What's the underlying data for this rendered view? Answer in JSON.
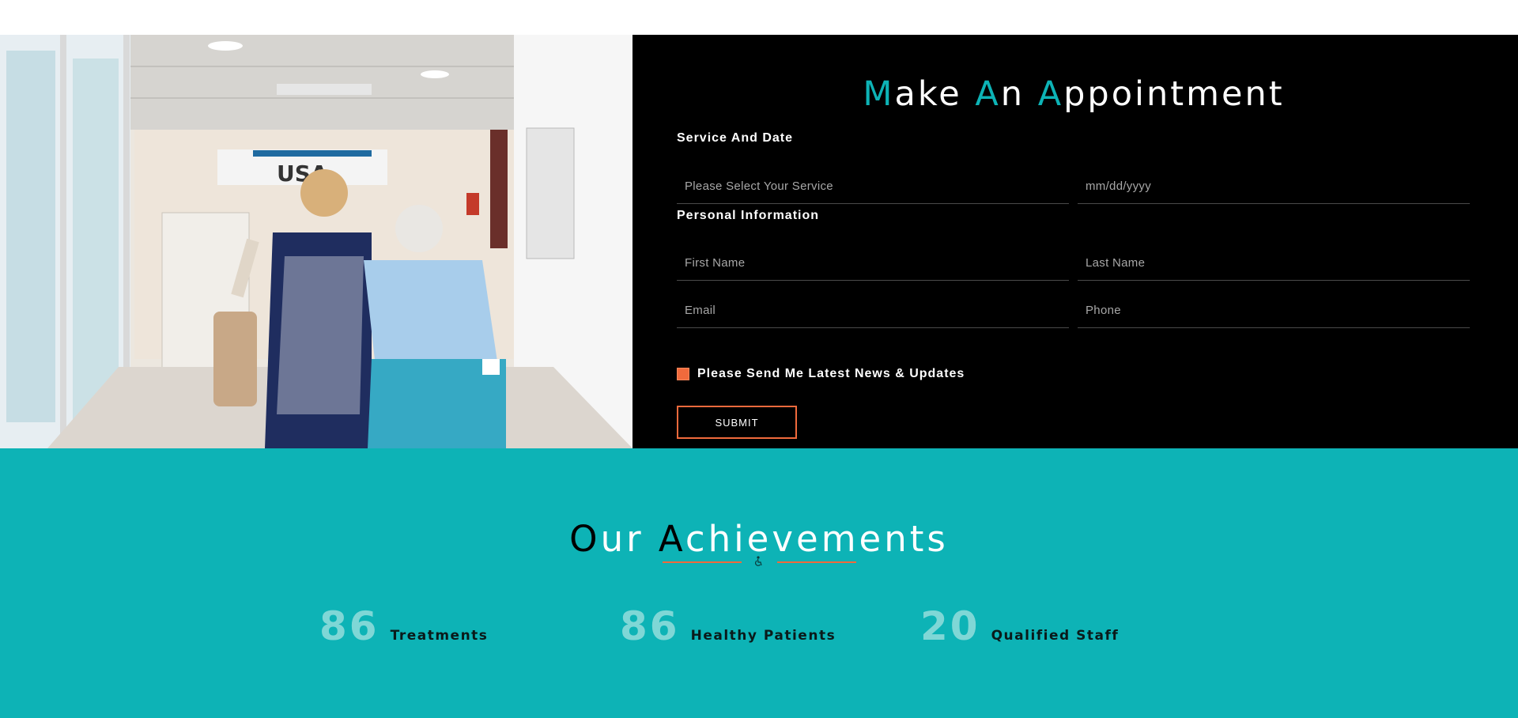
{
  "appointment": {
    "title": {
      "m": "M",
      "ake": "ake ",
      "a1": "A",
      "n": "n ",
      "a2": "A",
      "ppointment": "ppointment"
    },
    "service_group_label": "Service And Date",
    "service_placeholder": "Please Select Your Service",
    "date_placeholder": "mm/dd/yyyy",
    "personal_group_label": "Personal Information",
    "first_name_placeholder": "First Name",
    "last_name_placeholder": "Last Name",
    "email_placeholder": "Email",
    "phone_placeholder": "Phone",
    "newsletter_label": "Please Send Me Latest News & Updates",
    "submit_label": "SUBMIT",
    "background_icon": "wheelchair-icon"
  },
  "achievements": {
    "title": {
      "o": "O",
      "ur": "ur ",
      "a": "A",
      "chievements": "chievements"
    },
    "divider_icon": "wheelchair-icon",
    "stats": [
      {
        "value": "86",
        "label": "Treatments"
      },
      {
        "value": "86",
        "label": "Healthy Patients"
      },
      {
        "value": "20",
        "label": "Qualified Staff"
      }
    ]
  },
  "colors": {
    "accent_teal": "#0db3b6",
    "accent_orange": "#f06a3c",
    "form_background": "#000000"
  }
}
